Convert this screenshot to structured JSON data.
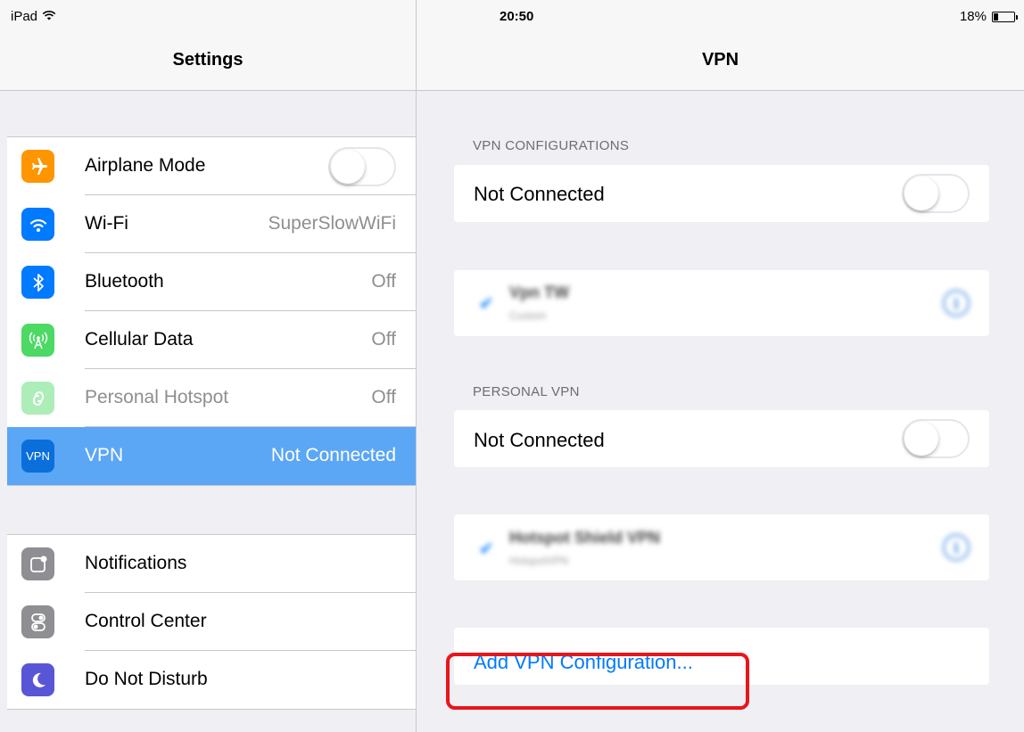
{
  "status_bar": {
    "device": "iPad",
    "time": "20:50",
    "battery": "18%"
  },
  "master": {
    "title": "Settings",
    "group1": [
      {
        "label": "Airplane Mode",
        "icon": "airplane-icon",
        "color": "#ff9500",
        "toggle": "off"
      },
      {
        "label": "Wi-Fi",
        "value": "SuperSlowWiFi",
        "icon": "wifi-icon",
        "color": "#007aff"
      },
      {
        "label": "Bluetooth",
        "value": "Off",
        "icon": "bluetooth-icon",
        "color": "#007aff"
      },
      {
        "label": "Cellular Data",
        "value": "Off",
        "icon": "antenna-icon",
        "color": "#4cd964"
      },
      {
        "label": "Personal Hotspot",
        "value": "Off",
        "icon": "hotspot-icon",
        "color": "#4cd964"
      },
      {
        "label": "VPN",
        "value": "Not Connected",
        "icon": "vpn-icon",
        "icon_text": "VPN",
        "color": "#0a6fdb",
        "selected": true
      }
    ],
    "group2": [
      {
        "label": "Notifications",
        "icon": "notifications-icon",
        "color": "#8e8e93"
      },
      {
        "label": "Control Center",
        "icon": "control-center-icon",
        "color": "#8e8e93"
      },
      {
        "label": "Do Not Disturb",
        "icon": "moon-icon",
        "color": "#5856d6"
      }
    ]
  },
  "detail": {
    "title": "VPN",
    "vpn_configurations_header": "VPN CONFIGURATIONS",
    "vpn_status": "Not Connected",
    "config_item": {
      "name": "Vpn TW",
      "subtitle": "Custom"
    },
    "personal_vpn_header": "PERSONAL VPN",
    "personal_status": "Not Connected",
    "personal_item": {
      "name": "Hotspot Shield VPN",
      "subtitle": "HotspotVPN"
    },
    "add_config_label": "Add VPN Configuration..."
  }
}
